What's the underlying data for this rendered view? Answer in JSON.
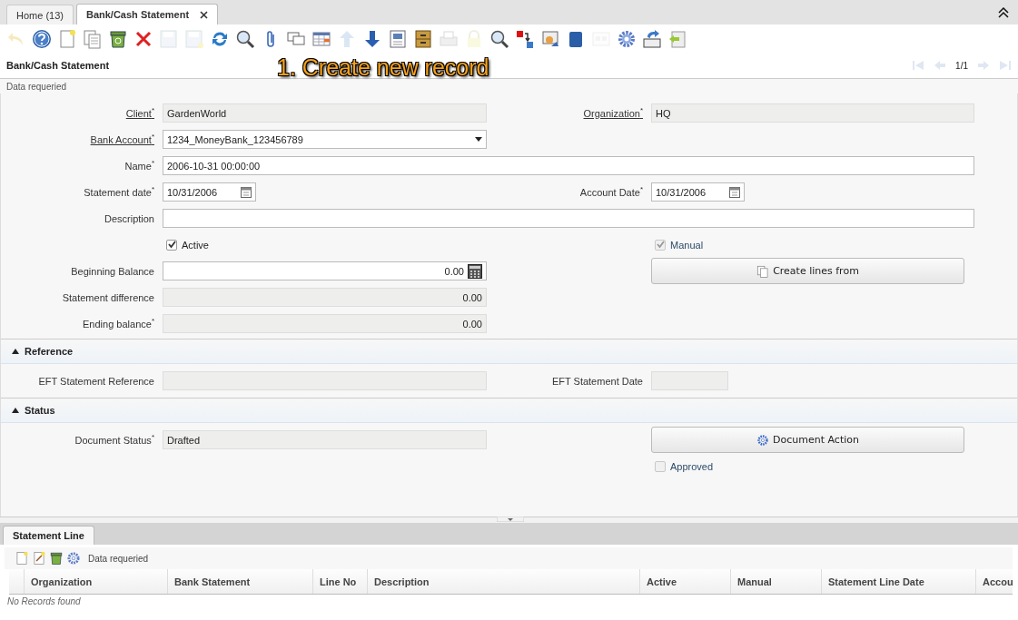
{
  "tabs": [
    {
      "label": "Home (13)",
      "selected": false,
      "closable": false
    },
    {
      "label": "Bank/Cash Statement",
      "selected": true,
      "closable": true
    }
  ],
  "toolbar": [
    {
      "kind": "undo",
      "disabled": true
    },
    {
      "kind": "help",
      "disabled": false
    },
    {
      "kind": "new",
      "disabled": false
    },
    {
      "kind": "copy",
      "disabled": false
    },
    {
      "kind": "trash",
      "disabled": false
    },
    {
      "kind": "delete",
      "disabled": false
    },
    {
      "kind": "save",
      "disabled": true
    },
    {
      "kind": "save-new",
      "disabled": true
    },
    {
      "kind": "refresh",
      "disabled": false
    },
    {
      "kind": "search",
      "disabled": false
    },
    {
      "kind": "attach",
      "disabled": false
    },
    {
      "kind": "chat",
      "disabled": false
    },
    {
      "kind": "grid",
      "disabled": false
    },
    {
      "kind": "up",
      "disabled": true
    },
    {
      "kind": "down",
      "disabled": false
    },
    {
      "kind": "report",
      "disabled": false
    },
    {
      "kind": "archive",
      "disabled": false
    },
    {
      "kind": "print",
      "disabled": true
    },
    {
      "kind": "lock",
      "disabled": true
    },
    {
      "kind": "zoom",
      "disabled": false
    },
    {
      "kind": "move",
      "disabled": false
    },
    {
      "kind": "mail",
      "disabled": false
    },
    {
      "kind": "block",
      "disabled": false
    },
    {
      "kind": "cards",
      "disabled": true
    },
    {
      "kind": "gear",
      "disabled": false
    },
    {
      "kind": "import",
      "disabled": false
    },
    {
      "kind": "export",
      "disabled": false
    }
  ],
  "header": {
    "title": "Bank/Cash Statement",
    "pager": "1/1"
  },
  "annotation": "1. Create new record",
  "message": "Data requeried",
  "main_rows": [
    {
      "left": {
        "kind": "text",
        "label": "Client$^{*}$",
        "value": "GardenWorld",
        "readonly": true,
        "link": true
      },
      "right": {
        "kind": "text",
        "label": "Organization$^{*}$",
        "value": "HQ",
        "readonly": true,
        "link": true
      }
    },
    {
      "left": {
        "kind": "select",
        "label": "Bank Account$^{*}$",
        "value": "1234_MoneyBank_123456789",
        "readonly": false,
        "link": true
      }
    },
    {
      "left": {
        "kind": "text",
        "label": "Name$^{*}$",
        "value": "2006-10-31 00:00:00",
        "readonly": false,
        "link": false,
        "wide": true
      }
    },
    {
      "left": {
        "kind": "date",
        "label": "Statement date$^{*}$",
        "value": "10/31/2006",
        "readonly": false,
        "link": false
      },
      "right": {
        "kind": "date",
        "label": "Account Date$^{*}$",
        "value": "10/31/2006",
        "readonly": false,
        "link": false
      }
    },
    {
      "left": {
        "kind": "text",
        "label": "Description",
        "readonly": false,
        "link": false,
        "wide": true
      }
    },
    {
      "left": {
        "kind": "checkbox",
        "label": "Active",
        "checked": true,
        "disabled": false
      },
      "right": {
        "kind": "checkbox",
        "label": "Manual",
        "checked": true,
        "disabled": true
      }
    },
    {
      "left": {
        "kind": "number",
        "label": "Beginning Balance",
        "value": "0.00",
        "readonly": false,
        "link": false
      },
      "right": {
        "kind": "lines-button",
        "label": "Create lines from"
      }
    },
    {
      "left": {
        "kind": "number",
        "label": "Statement difference",
        "value": "0.00",
        "readonly": true,
        "link": false
      }
    },
    {
      "left": {
        "kind": "number",
        "label": "Ending balance$^{*}$",
        "value": "0.00",
        "readonly": true,
        "link": false
      }
    }
  ],
  "sections": [
    {
      "title": "Reference",
      "expanded": true,
      "rows": [
        {
          "left": {
            "kind": "text",
            "label": "EFT Statement Reference",
            "readonly": true,
            "link": false
          },
          "right": {
            "kind": "date",
            "label": "EFT Statement Date",
            "readonly": true,
            "link": false
          }
        }
      ]
    },
    {
      "title": "Status",
      "expanded": true,
      "rows": [
        {
          "left": {
            "kind": "text",
            "label": "Document Status$^{*}$",
            "value": "Drafted",
            "readonly": true,
            "link": false
          },
          "right": {
            "kind": "action-button",
            "label": "Document Action"
          }
        },
        {
          "right": {
            "kind": "checkbox",
            "label": "Approved",
            "checked": false,
            "disabled": true
          }
        }
      ]
    }
  ],
  "detail": {
    "tab": {
      "label": "Statement Line",
      "selected": true
    },
    "toolbar": [
      {
        "kind": "new"
      },
      {
        "kind": "edit"
      },
      {
        "kind": "trash"
      },
      {
        "kind": "gear"
      }
    ],
    "message": "Data requeried",
    "columns": [
      "Organization",
      "Bank Statement",
      "Line No",
      "Description",
      "Active",
      "Manual",
      "Statement Line Date",
      "Accou"
    ],
    "empty": "No Records found"
  }
}
